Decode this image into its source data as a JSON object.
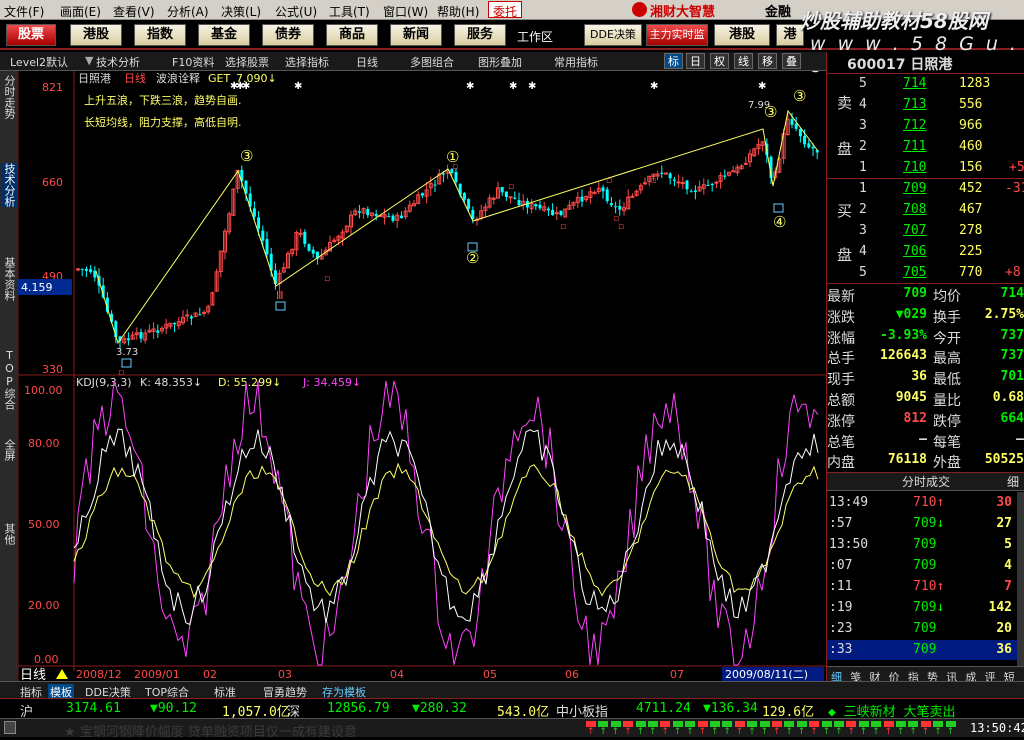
{
  "menu": [
    "文件(F)",
    "画面(E)",
    "查看(V)",
    "分析(A)",
    "决策(L)",
    "公式(U)",
    "工具(T)",
    "窗口(W)",
    "帮助(H)"
  ],
  "menu_trade": "委托",
  "brand": "湘财大智慧",
  "brand2": "金融",
  "watermark": "炒股辅助教材58股网",
  "watermark_url": "w w w . 5 8 G u . c o m",
  "toolbar": [
    "股票",
    "港股",
    "指数",
    "基金",
    "债券",
    "商品",
    "新闻",
    "服务"
  ],
  "toolbar_workspace": "工作区",
  "toolbar_right": [
    "DDE决策",
    "主力实时监",
    "港股",
    "港"
  ],
  "subbar": {
    "items": [
      "Level2默认",
      "技术分析",
      "F10资料",
      "选择股票",
      "选择指标",
      "日线",
      "多图组合",
      "图形叠加",
      "常用指标"
    ],
    "buttons": [
      "标",
      "日",
      "权",
      "线",
      "移",
      "叠"
    ]
  },
  "lefttabs": [
    "分时走势",
    "技术分析",
    "基本资料",
    "TOP综合",
    "全屏",
    "其他"
  ],
  "chart": {
    "stock_name": "日照港",
    "period": "日线",
    "indicator": "波浪诠释",
    "get_label": "GET",
    "get_value": "7.090↓",
    "ann1": "上升五浪，下跌三浪，趋势自画.",
    "ann2": "长短均线，阻力支撑，高低自明.",
    "price_ticks": [
      "821",
      "660",
      "490",
      "330"
    ],
    "left_price": "4.159",
    "low_label": "3.73",
    "high_label": "7.99",
    "kdj_label": "KDJ(9,3,3)",
    "kdj_k": "K: 48.353↓",
    "kdj_d": "D: 55.299↓",
    "kdj_j": "J: 34.459↓",
    "kdj_ticks": [
      "100.00",
      "80.00",
      "50.00",
      "20.00",
      "0.00"
    ],
    "dates": [
      "2008/12",
      "2009/01",
      "02",
      "03",
      "04",
      "05",
      "06",
      "07"
    ],
    "date_current": "2009/08/11(二)",
    "period_tab": "日线",
    "wave_labels": {
      "top3a": "③",
      "top1": "①",
      "top3b": "③",
      "top3c": "③",
      "low2": "②",
      "low4": "④",
      "low3": "Ⅲ"
    }
  },
  "quote": {
    "code": "600017",
    "name": "日照港",
    "sell_label": [
      "卖",
      "盘"
    ],
    "buy_label": [
      "买",
      "盘"
    ],
    "asks": [
      {
        "n": "5",
        "p": "714",
        "v": "1283"
      },
      {
        "n": "4",
        "p": "713",
        "v": "556"
      },
      {
        "n": "3",
        "p": "712",
        "v": "966"
      },
      {
        "n": "2",
        "p": "711",
        "v": "460"
      },
      {
        "n": "1",
        "p": "710",
        "v": "156",
        "d": "+5"
      }
    ],
    "bids": [
      {
        "n": "1",
        "p": "709",
        "v": "452",
        "d": "-31"
      },
      {
        "n": "2",
        "p": "708",
        "v": "467"
      },
      {
        "n": "3",
        "p": "707",
        "v": "278"
      },
      {
        "n": "4",
        "p": "706",
        "v": "225"
      },
      {
        "n": "5",
        "p": "705",
        "v": "770",
        "d": "+8"
      }
    ],
    "stats": [
      {
        "l": "最新",
        "v": "709",
        "c": "cg",
        "l2": "均价",
        "v2": "714",
        "c2": "cg"
      },
      {
        "l": "涨跌",
        "v": "▼029",
        "c": "cg",
        "l2": "换手",
        "v2": "2.75%",
        "c2": "cy"
      },
      {
        "l": "涨幅",
        "v": "-3.93%",
        "c": "cg",
        "l2": "今开",
        "v2": "737",
        "c2": "cg"
      },
      {
        "l": "总手",
        "v": "126643",
        "c": "cy",
        "l2": "最高",
        "v2": "737",
        "c2": "cg"
      },
      {
        "l": "现手",
        "v": "36",
        "c": "cy",
        "l2": "最低",
        "v2": "701",
        "c2": "cg"
      },
      {
        "l": "总额",
        "v": "9045",
        "c": "cy",
        "l2": "量比",
        "v2": "0.68",
        "c2": "cy"
      },
      {
        "l": "涨停",
        "v": "812",
        "c": "cr",
        "l2": "跌停",
        "v2": "664",
        "c2": "cg"
      },
      {
        "l": "总笔",
        "v": "–",
        "c": "cw",
        "l2": "每笔",
        "v2": "–",
        "c2": "cw"
      },
      {
        "l": "内盘",
        "v": "76118",
        "c": "cy",
        "l2": "外盘",
        "v2": "50525",
        "c2": "cy"
      }
    ],
    "trade_header": "分时成交",
    "trade_detail": "细",
    "trades": [
      {
        "t": "13:49",
        "p": "710↑",
        "v": "30",
        "pc": "cr",
        "vc": "cr"
      },
      {
        "t": ":57",
        "p": "709↓",
        "v": "27",
        "pc": "cg",
        "vc": "cy"
      },
      {
        "t": "13:50",
        "p": "709",
        "v": "5",
        "pc": "cg",
        "vc": "cy"
      },
      {
        "t": ":07",
        "p": "709",
        "v": "4",
        "pc": "cg",
        "vc": "cy"
      },
      {
        "t": ":11",
        "p": "710↑",
        "v": "7",
        "pc": "cr",
        "vc": "cr"
      },
      {
        "t": ":19",
        "p": "709↓",
        "v": "142",
        "pc": "cg",
        "vc": "cy"
      },
      {
        "t": ":23",
        "p": "709",
        "v": "20",
        "pc": "cg",
        "vc": "cy"
      },
      {
        "t": ":33",
        "p": "709",
        "v": "36",
        "pc": "cg",
        "vc": "cy"
      }
    ],
    "tabs": [
      "细",
      "笺",
      "财",
      "价",
      "指",
      "势",
      "讯",
      "成",
      "评",
      "短"
    ]
  },
  "bottom_tabs": [
    "指标",
    "模板",
    "DDE决策",
    "TOP综合",
    "标准",
    "冒勇趋势",
    "存为模板"
  ],
  "status": {
    "sh_label": "沪",
    "sh_idx": "3174.61",
    "sh_chg": "▼90.12",
    "sh_amt": "1,057.0亿",
    "sz_label": "深",
    "sz_idx": "12856.79",
    "sz_chg": "▼280.32",
    "sz_amt": "543.0亿",
    "sme_label": "中小板指",
    "sme_idx": "4711.24",
    "sme_chg": "▼136.34",
    "sme_amt": "129.6亿",
    "news": "◆ 三峡新材 大笔卖出"
  },
  "ticker": {
    "text": "★ 宝钢河钢降价幅度 贷单融资项目仅一成有建设意",
    "time": "13:50:42"
  }
}
